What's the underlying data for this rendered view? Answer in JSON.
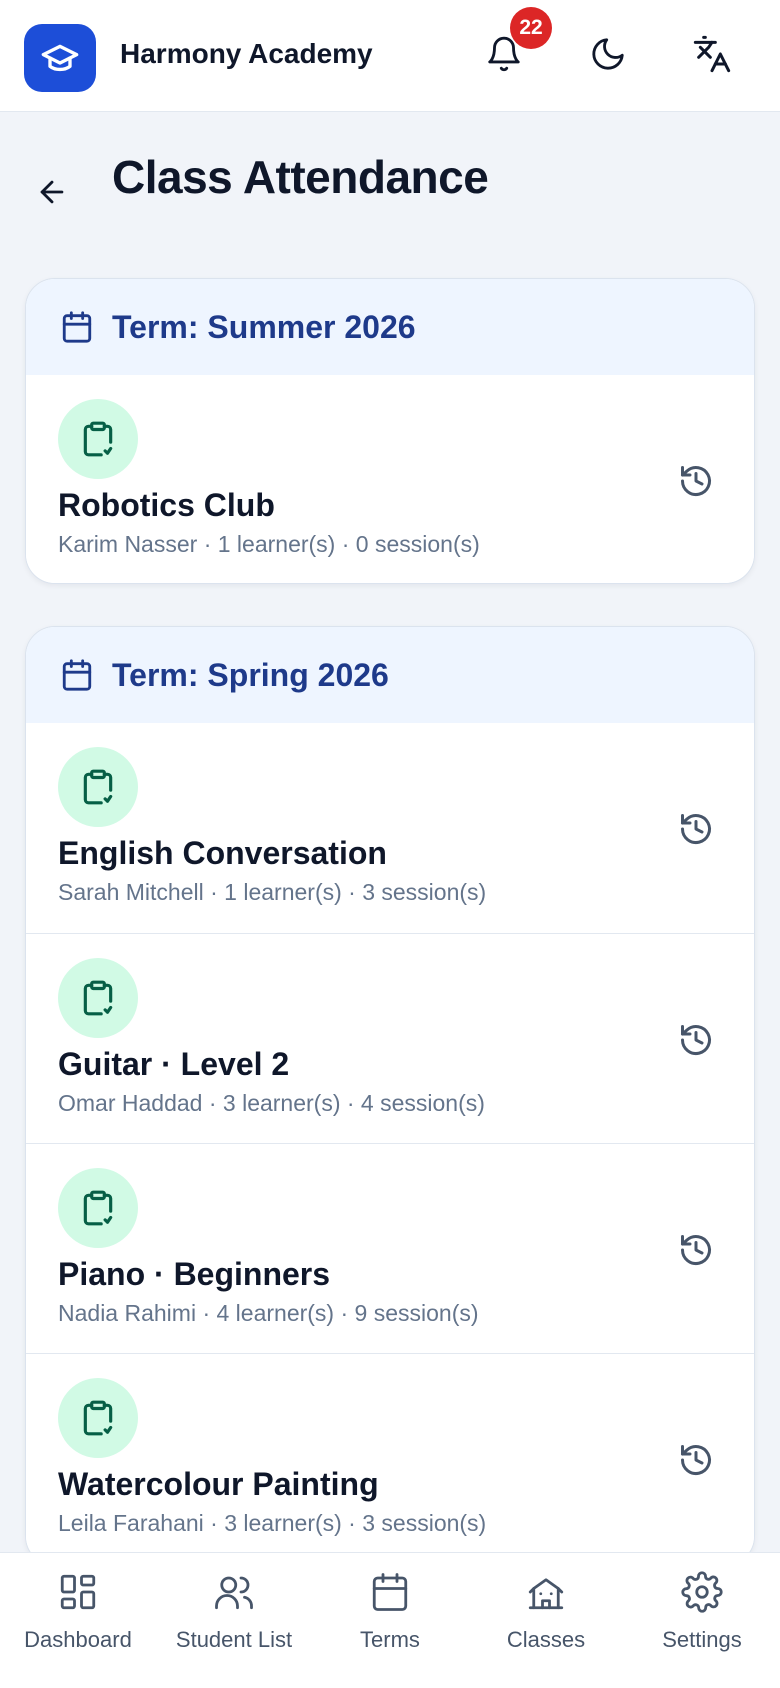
{
  "header": {
    "app_title": "Harmony Academy",
    "notification_count": "22",
    "icons": [
      "graduation-cap-icon",
      "bell-icon",
      "moon-icon",
      "translate-icon"
    ]
  },
  "page": {
    "title": "Class Attendance"
  },
  "terms": [
    {
      "title": "Term: Summer 2026",
      "classes": [
        {
          "name": "Robotics Club",
          "meta": "Karim Nasser · 1 learner(s) · 0 session(s)"
        }
      ]
    },
    {
      "title": "Term: Spring 2026",
      "classes": [
        {
          "name": "English Conversation",
          "meta": "Sarah Mitchell · 1 learner(s) · 3 session(s)"
        },
        {
          "name": "Guitar · Level 2",
          "meta": "Omar Haddad · 3 learner(s) · 4 session(s)"
        },
        {
          "name": "Piano · Beginners",
          "meta": "Nadia Rahimi · 4 learner(s) · 9 session(s)"
        },
        {
          "name": "Watercolour Painting",
          "meta": "Leila Farahani · 3 learner(s) · 3 session(s)"
        }
      ]
    }
  ],
  "nav": {
    "items": [
      {
        "label": "Dashboard"
      },
      {
        "label": "Student List"
      },
      {
        "label": "Terms"
      },
      {
        "label": "Classes"
      },
      {
        "label": "Settings"
      }
    ]
  },
  "colors": {
    "brand": "#1d4ed8",
    "badge": "#dc2626",
    "term_title": "#1e3a8a",
    "term_header_bg": "#eef5ff",
    "class_icon_bg": "#d1fae5",
    "class_icon_fg": "#065f46"
  }
}
